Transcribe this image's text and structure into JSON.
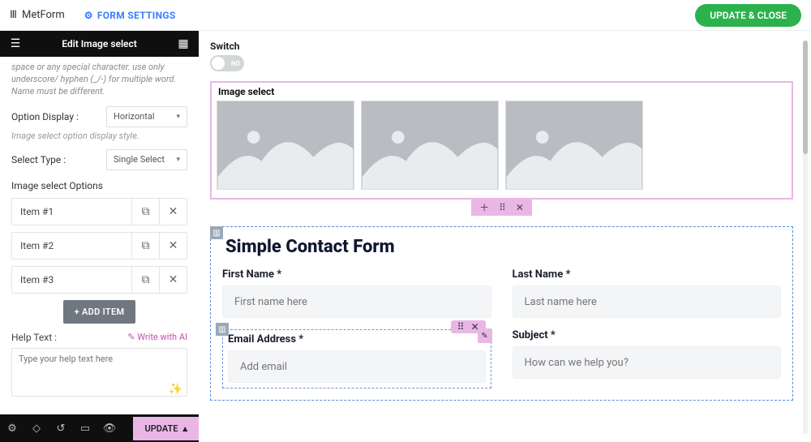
{
  "top": {
    "brand": "MetForm",
    "form_settings": "FORM SETTINGS",
    "update_close": "UPDATE & CLOSE"
  },
  "panel": {
    "title": "Edit Image select",
    "name_hint": "space or any special character. use only underscore/ hyphen (_/-) for multiple word. Name must be different.",
    "option_display_label": "Option Display :",
    "option_display_value": "Horizontal",
    "option_display_hint": "Image select option display style.",
    "select_type_label": "Select Type :",
    "select_type_value": "Single Select",
    "options_title": "Image select Options",
    "options": [
      {
        "label": "Item #1"
      },
      {
        "label": "Item #2"
      },
      {
        "label": "Item #3"
      }
    ],
    "add_item": "+  ADD ITEM",
    "help_label": "Help Text :",
    "write_ai": "✎ Write with AI",
    "help_placeholder": "Type your help text here",
    "footer_update": "UPDATE"
  },
  "canvas": {
    "switch_label": "Switch",
    "switch_state": "NO",
    "image_select_title": "Image select",
    "form_title": "Simple Contact Form",
    "fields": {
      "first_name_label": "First Name *",
      "first_name_ph": "First name here",
      "last_name_label": "Last Name *",
      "last_name_ph": "Last name here",
      "email_label": "Email Address *",
      "email_ph": "Add email",
      "subject_label": "Subject *",
      "subject_ph": "How can we help you?"
    }
  }
}
